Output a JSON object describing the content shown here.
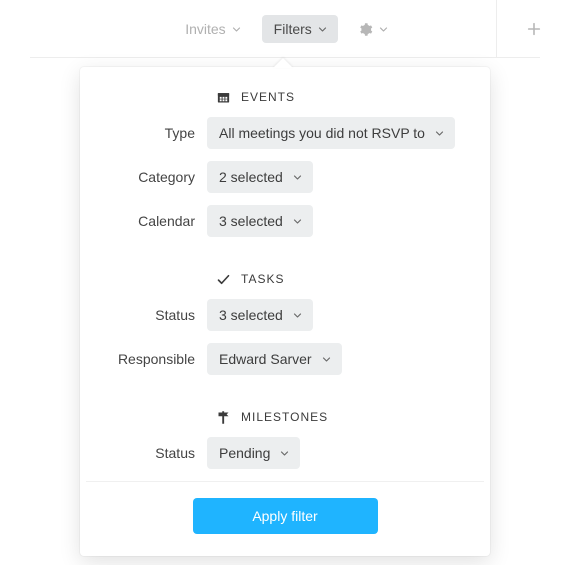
{
  "toolbar": {
    "invites_label": "Invites",
    "filters_label": "Filters"
  },
  "panel": {
    "sections": {
      "events": {
        "title": "EVENTS",
        "type_label": "Type",
        "type_value": "All meetings you did not RSVP to",
        "category_label": "Category",
        "category_value": "2 selected",
        "calendar_label": "Calendar",
        "calendar_value": "3 selected"
      },
      "tasks": {
        "title": "TASKS",
        "status_label": "Status",
        "status_value": "3 selected",
        "responsible_label": "Responsible",
        "responsible_value": "Edward Sarver"
      },
      "milestones": {
        "title": "MILESTONES",
        "status_label": "Status",
        "status_value": "Pending"
      }
    },
    "apply_label": "Apply filter"
  }
}
